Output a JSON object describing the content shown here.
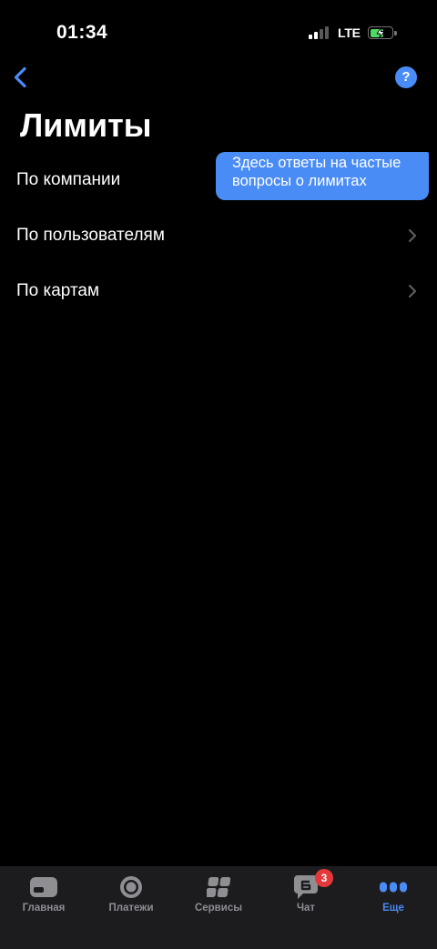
{
  "status_bar": {
    "time": "01:34",
    "network": "LTE",
    "signal_icon": "signal-bars-icon",
    "signal_level": 2,
    "battery_icon": "battery-charging-icon",
    "battery_level": 0.65
  },
  "header": {
    "back_icon": "chevron-left-icon",
    "help_label": "?"
  },
  "page": {
    "title": "Лимиты"
  },
  "menu": {
    "item_icon": "chevron-right-icon",
    "items": [
      {
        "label": "По компании"
      },
      {
        "label": "По пользователям"
      },
      {
        "label": "По картам"
      }
    ]
  },
  "tooltip": {
    "text": "Здесь ответы на частые вопросы о лимитах"
  },
  "tabbar": {
    "items": [
      {
        "label": "Главная",
        "icon": "home-icon",
        "active": false
      },
      {
        "label": "Платежи",
        "icon": "payments-icon",
        "active": false
      },
      {
        "label": "Сервисы",
        "icon": "services-grid-icon",
        "active": false
      },
      {
        "label": "Чат",
        "icon": "chat-icon",
        "badge": "3",
        "active": false
      },
      {
        "label": "Еще",
        "icon": "more-icon",
        "active": true
      }
    ]
  },
  "colors": {
    "background": "#000000",
    "accent": "#4a8cf6",
    "tooltip": "#4a8cf6",
    "tabbar_bg": "#1c1c1e",
    "inactive": "#8e8e93",
    "chevron": "#5b5b60",
    "badge": "#e5383b",
    "battery": "#4cd964"
  }
}
